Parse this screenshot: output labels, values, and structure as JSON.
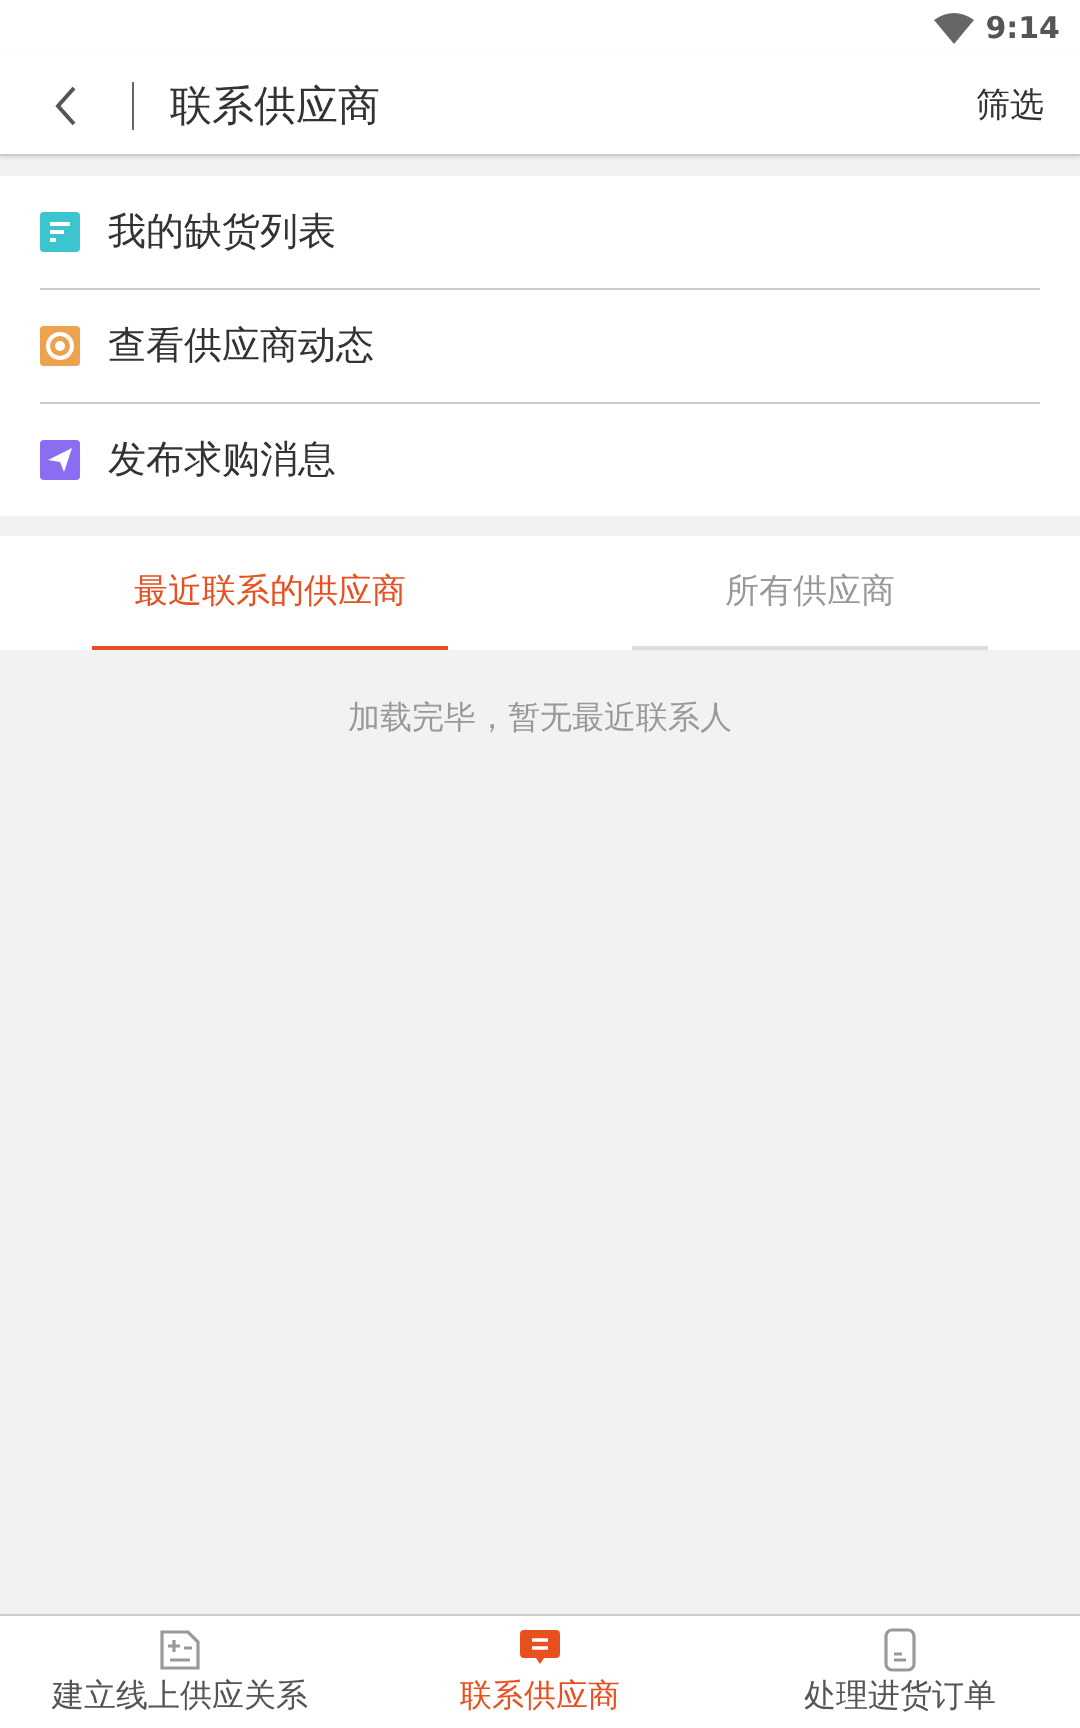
{
  "status_bar": {
    "time": "9:14"
  },
  "header": {
    "title": "联系供应商",
    "action": "筛选"
  },
  "menu": [
    {
      "kind": "list",
      "label": "我的缺货列表",
      "color": "#3cc5cf"
    },
    {
      "kind": "aperture",
      "label": "查看供应商动态",
      "color": "#eda24e"
    },
    {
      "kind": "send",
      "label": "发布求购消息",
      "color": "#8a6df0"
    }
  ],
  "tabs": [
    {
      "label": "最近联系的供应商",
      "selected": true
    },
    {
      "label": "所有供应商",
      "selected": false
    }
  ],
  "empty_message": "加载完毕，暂无最近联系人",
  "bottom_nav": [
    {
      "kind": "add",
      "label": "建立线上供应关系",
      "selected": false
    },
    {
      "kind": "chat",
      "label": "联系供应商",
      "selected": true
    },
    {
      "kind": "doc",
      "label": "处理进货订单",
      "selected": false
    }
  ]
}
